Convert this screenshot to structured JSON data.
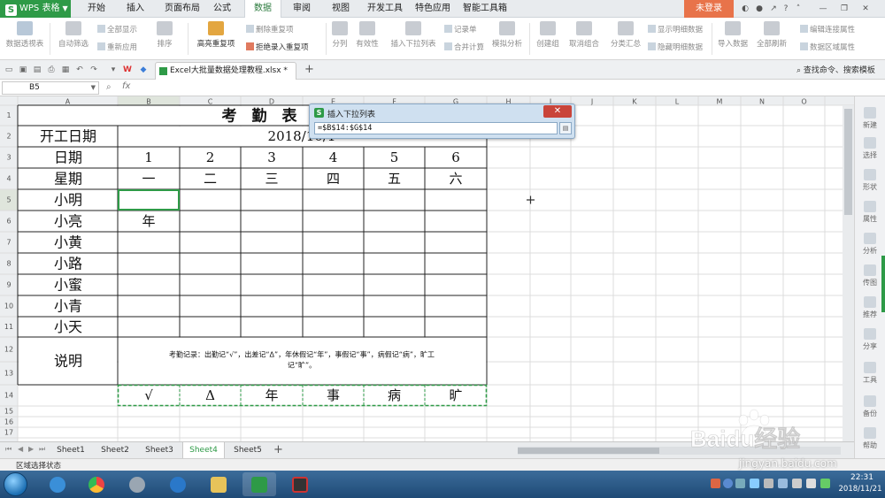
{
  "app": {
    "name": "WPS 表格",
    "login": "未登录"
  },
  "tabs": [
    "开始",
    "插入",
    "页面布局",
    "公式",
    "数据",
    "审阅",
    "视图",
    "开发工具",
    "特色应用",
    "智能工具箱"
  ],
  "active_tab": "数据",
  "ribbon": {
    "pivot": "数据透视表",
    "autofilter": "自动筛选",
    "show_all": "全部显示",
    "reapply": "重新应用",
    "sort": "排序",
    "highlight_dup": "高亮重复项",
    "remove_dup": "删除重复项",
    "reject_dup": "拒绝录入重复项",
    "split": "分列",
    "validity": "有效性",
    "insert_dropdown": "插入下拉列表",
    "record_form": "记录单",
    "consolidate": "合并计算",
    "what_if": "模拟分析",
    "group": "创建组",
    "ungroup": "取消组合",
    "subtotal": "分类汇总",
    "show_detail": "显示明细数据",
    "hide_detail": "隐藏明细数据",
    "import": "导入数据",
    "refresh_all": "全部刷新",
    "edit_links": "编辑连接属性",
    "region_props": "数据区域属性"
  },
  "file_tab": "Excel大批量数据处理教程.xlsx *",
  "search_cmd": "查找命令、搜索模板",
  "name_box": "B5",
  "fx": "fx",
  "columns": [
    "A",
    "B",
    "C",
    "D",
    "E",
    "F",
    "G",
    "H",
    "I",
    "J",
    "K",
    "L",
    "M",
    "N",
    "O"
  ],
  "rows": [
    "1",
    "2",
    "3",
    "4",
    "5",
    "6",
    "7",
    "8",
    "9",
    "10",
    "11",
    "12",
    "13",
    "14",
    "15",
    "16",
    "17"
  ],
  "sheet": {
    "title": "考　勤　表",
    "start_label": "开工日期",
    "start_date": "2018/10/1",
    "date_label": "日期",
    "dates": [
      "1",
      "2",
      "3",
      "4",
      "5",
      "6"
    ],
    "week_label": "星期",
    "weekdays": [
      "一",
      "二",
      "三",
      "四",
      "五",
      "六"
    ],
    "names": [
      "小明",
      "小亮",
      "小黄",
      "小路",
      "小蜜",
      "小青",
      "小天"
    ],
    "b6_value": "年",
    "note_label": "说明",
    "note_line1": "考勤记录：出勤记“√”，出差记“Δ”，年休假记“年”，事假记“事”，病假记“病”，旷工",
    "note_line2": "记“旷”。",
    "symbols": [
      "√",
      "Δ",
      "年",
      "事",
      "病",
      "旷"
    ]
  },
  "dialog": {
    "title": "插入下拉列表",
    "value": "=$B$14:$G$14"
  },
  "sheet_tabs": [
    "Sheet1",
    "Sheet2",
    "Sheet3",
    "Sheet4",
    "Sheet5"
  ],
  "active_sheet": "Sheet4",
  "status": "区域选择状态",
  "right_pane": [
    "新建",
    "选择",
    "形状",
    "属性",
    "分析",
    "传图",
    "推荐",
    "分享",
    "工具",
    "备份",
    "帮助"
  ],
  "clock": {
    "time": "22:31",
    "date": "2018/11/21"
  },
  "watermark": {
    "brand": "Baidu经验",
    "url": "jingyan.baidu.com"
  },
  "colors": {
    "wps_green": "#2e9a47",
    "login_orange": "#e8734a",
    "selection_green": "#2e9a47"
  }
}
